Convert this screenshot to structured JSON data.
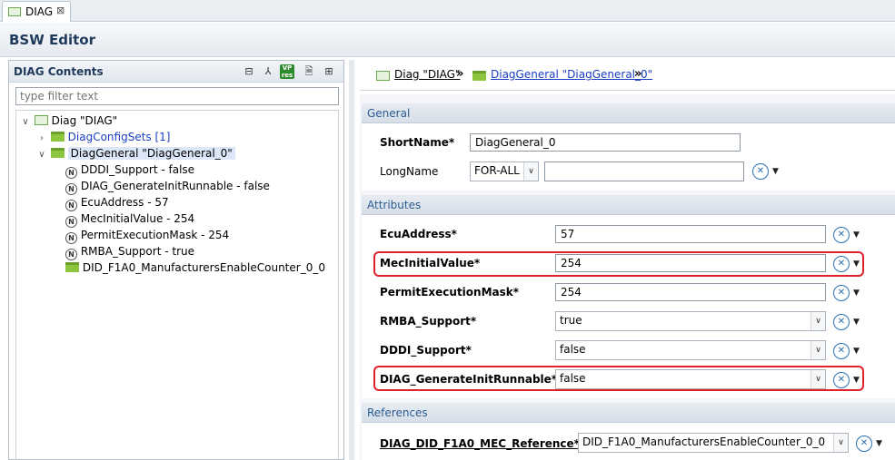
{
  "tab": {
    "label": "DIAG",
    "close": "⊠"
  },
  "editor": {
    "title": "BSW Editor"
  },
  "left": {
    "title": "DIAG Contents",
    "filter_placeholder": "type filter text",
    "tools": {
      "collapse": "⊟",
      "tree": "⅄",
      "vp_top": "VP",
      "vp_bottom": "res",
      "doc": "🗎",
      "grid": "⊞"
    },
    "tree": {
      "root": "Diag \"DIAG\"",
      "config_sets": "DiagConfigSets [1]",
      "general": "DiagGeneral \"DiagGeneral_0\"",
      "params": [
        "DDDI_Support - false",
        "DIAG_GenerateInitRunnable - false",
        "EcuAddress - 57",
        "MecInitialValue - 254",
        "PermitExecutionMask - 254",
        "RMBA_Support - true"
      ],
      "did": "DID_F1A0_ManufacturersEnableCounter_0_0",
      "n_glyph": "N"
    }
  },
  "breadcrumb": {
    "item1": "Diag \"DIAG\"",
    "item2": "DiagGeneral \"DiagGeneral_0\"",
    "sep": "»"
  },
  "general": {
    "title": "General",
    "shortname_label": "ShortName*",
    "shortname_value": "DiagGeneral_0",
    "longname_label": "LongName",
    "longname_lang": "FOR-ALL",
    "longname_value": ""
  },
  "attributes": {
    "title": "Attributes",
    "ecu_label": "EcuAddress*",
    "ecu_value": "57",
    "mec_label": "MecInitialValue*",
    "mec_value": "254",
    "pem_label": "PermitExecutionMask*",
    "pem_value": "254",
    "rmba_label": "RMBA_Support*",
    "rmba_value": "true",
    "dddi_label": "DDDI_Support*",
    "dddi_value": "false",
    "gir_label": "DIAG_GenerateInitRunnable*",
    "gir_value": "false"
  },
  "references": {
    "title": "References",
    "did_label": "DIAG_DID_F1A0_MEC_Reference*",
    "did_value": "DID_F1A0_ManufacturersEnableCounter_0_0"
  },
  "glyphs": {
    "x_icon": "✕",
    "drop": "▼",
    "combo_arrow": "∨",
    "chev_down": "∨",
    "chev_right": "›"
  }
}
